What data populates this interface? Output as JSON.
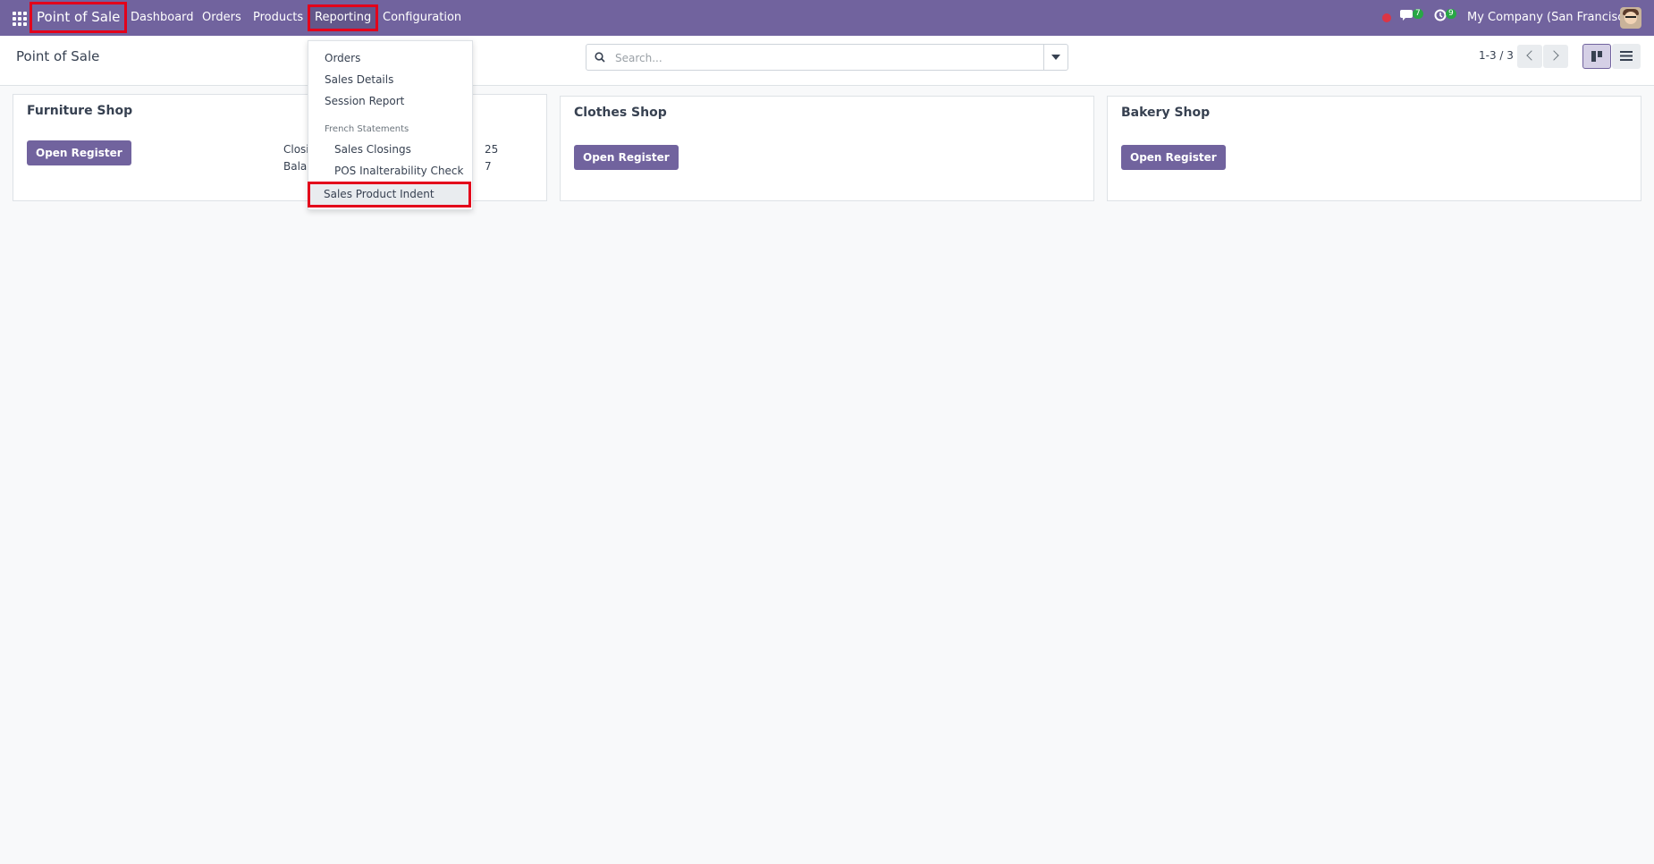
{
  "navbar": {
    "brand": "Point of Sale",
    "menu": [
      "Dashboard",
      "Orders",
      "Products",
      "Reporting",
      "Configuration"
    ],
    "messages_count": "7",
    "activities_count": "9",
    "company": "My Company (San Francisco)"
  },
  "control_panel": {
    "title": "Point of Sale",
    "search_placeholder": "Search...",
    "pager": "1-3 / 3"
  },
  "reporting_menu": {
    "items": [
      "Orders",
      "Sales Details",
      "Session Report"
    ],
    "section_header": "French Statements",
    "sub_items": [
      "Sales Closings",
      "POS Inalterability Check"
    ],
    "highlighted_item": "Sales Product Indent"
  },
  "cards": [
    {
      "title": "Furniture Shop",
      "button": "Open Register",
      "line1_start": "Closi",
      "line1_end": "25",
      "line2_start": "Balan",
      "line2_end": "7"
    },
    {
      "title": "Clothes Shop",
      "button": "Open Register"
    },
    {
      "title": "Bakery Shop",
      "button": "Open Register"
    }
  ],
  "colors": {
    "brand": "#71639e",
    "highlight": "#e3001b"
  }
}
